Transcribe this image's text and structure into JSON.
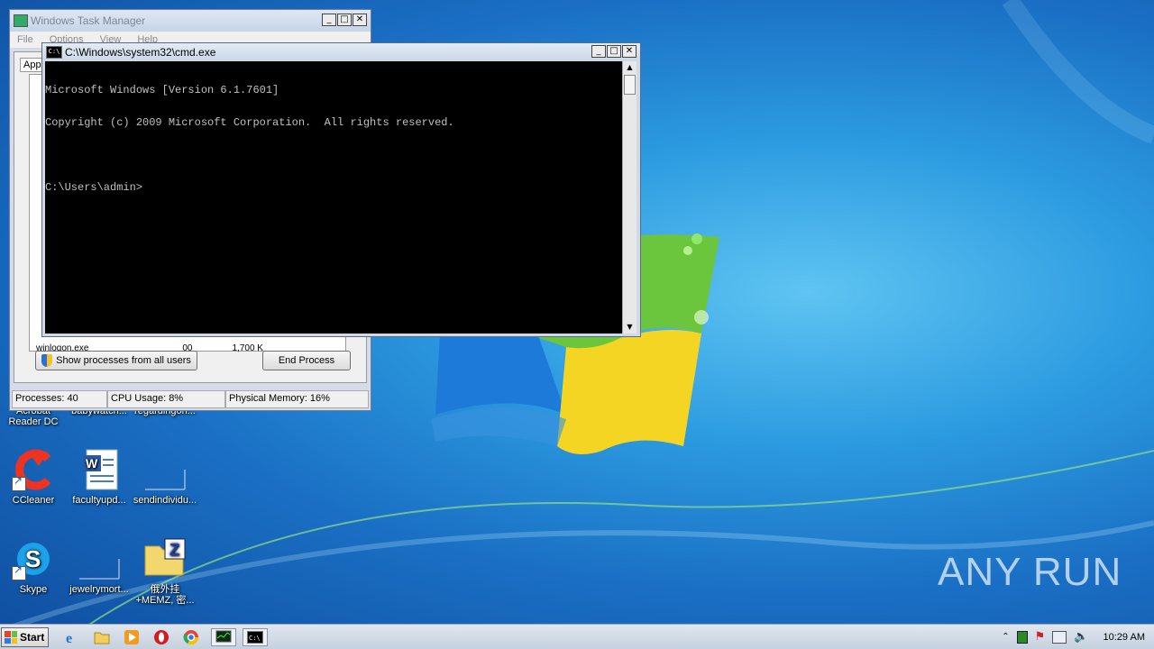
{
  "task_manager": {
    "title": "Windows Task Manager",
    "menu": [
      "File",
      "Options",
      "View",
      "Help"
    ],
    "tab_partial": "App",
    "visible_row": {
      "name": "winlogon.exe",
      "user": "00",
      "memory": "1,700 K"
    },
    "show_all_label": "Show processes from all users",
    "end_process_label": "End Process",
    "status": {
      "processes": "Processes: 40",
      "cpu": "CPU Usage: 8%",
      "memory": "Physical Memory: 16%"
    }
  },
  "cmd": {
    "title": "C:\\Windows\\system32\\cmd.exe",
    "lines": [
      "Microsoft Windows [Version 6.1.7601]",
      "Copyright (c) 2009 Microsoft Corporation.  All rights reserved.",
      "",
      "C:\\Users\\admin>"
    ]
  },
  "desktop_icons": [
    {
      "label": "Acrobat Reader DC",
      "icon": "acrobat-icon"
    },
    {
      "label": "babywatch...",
      "icon": "file-icon"
    },
    {
      "label": "regardingon...",
      "icon": "file-icon"
    },
    {
      "label": "CCleaner",
      "icon": "ccleaner-icon"
    },
    {
      "label": "facultyupd...",
      "icon": "word-document-icon"
    },
    {
      "label": "sendindividu...",
      "icon": "blank-file-icon"
    },
    {
      "label": "Skype",
      "icon": "skype-icon"
    },
    {
      "label": "jewelrymort...",
      "icon": "blank-file-icon"
    },
    {
      "label": "俄外挂 +MEMZ, 密...",
      "icon": "zip-folder-icon"
    }
  ],
  "taskbar": {
    "start_label": "Start",
    "clock": "10:29 AM",
    "pinned": [
      "internet-explorer-icon",
      "explorer-icon",
      "media-player-icon",
      "opera-icon",
      "chrome-icon",
      "task-manager-icon",
      "cmd-icon"
    ]
  },
  "watermark": "ANY RUN",
  "colors": {
    "desktop": "#1a6fc4",
    "console_bg": "#000000",
    "console_fg": "#c0c0c0"
  }
}
